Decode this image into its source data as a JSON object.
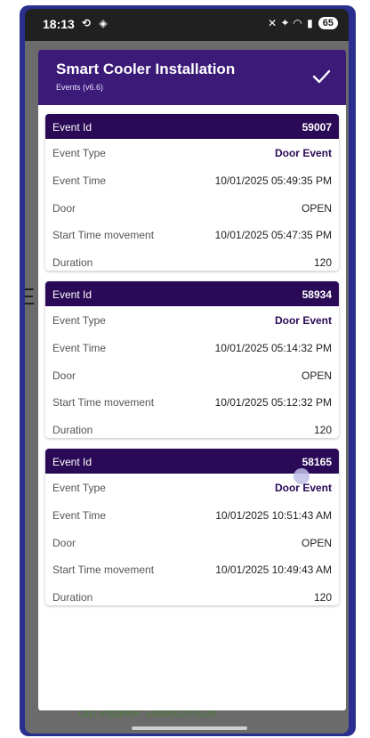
{
  "status_bar": {
    "time": "18:13",
    "left_icons": [
      "loop-icon",
      "shield-icon"
    ],
    "right_icons": [
      "mute-icon",
      "location-icon",
      "wifi-icon",
      "signal-icon"
    ],
    "battery": "65"
  },
  "background": {
    "bottom_text": "UID instance: 100000201030",
    "left_letter": "E"
  },
  "dialog": {
    "title": "Smart Cooler Installation",
    "subtitle": "Events (v6.6)",
    "confirm_icon": "check-icon"
  },
  "labels": {
    "event_id": "Event Id",
    "event_type": "Event Type",
    "event_time": "Event Time",
    "door": "Door",
    "start_time_movement": "Start Time movement",
    "duration": "Duration"
  },
  "events": [
    {
      "id": "59007",
      "type": "Door Event",
      "time": "10/01/2025 05:49:35 PM",
      "door": "OPEN",
      "start_time_movement": "10/01/2025 05:47:35 PM",
      "duration": "120"
    },
    {
      "id": "58934",
      "type": "Door Event",
      "time": "10/01/2025 05:14:32 PM",
      "door": "OPEN",
      "start_time_movement": "10/01/2025 05:12:32 PM",
      "duration": "120"
    },
    {
      "id": "58165",
      "type": "Door Event",
      "time": "10/01/2025 10:51:43 AM",
      "door": "OPEN",
      "start_time_movement": "10/01/2025 10:49:43 AM",
      "duration": "120"
    }
  ],
  "colors": {
    "header": "#3b1a78",
    "card_header": "#2a0a56",
    "frame": "#2a2f8f"
  }
}
